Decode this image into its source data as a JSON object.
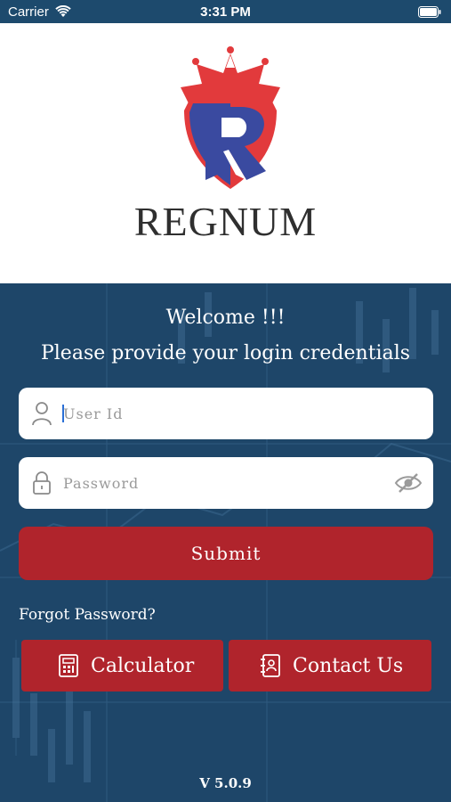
{
  "status_bar": {
    "carrier": "Carrier",
    "time": "3:31 PM"
  },
  "brand": {
    "name": "REGNUM",
    "logo_letter": "R"
  },
  "login": {
    "welcome": "Welcome !!!",
    "instruction": "Please provide your login credentials",
    "user_id": {
      "placeholder": "User Id",
      "value": ""
    },
    "password": {
      "placeholder": "Password",
      "value": ""
    },
    "submit_label": "Submit",
    "forgot_password": "Forgot Password?"
  },
  "actions": {
    "calculator_label": "Calculator",
    "contact_label": "Contact Us"
  },
  "version": "V 5.0.9",
  "colors": {
    "panel_bg": "#1e4669",
    "accent_red": "#b0242c",
    "logo_blue": "#3a4aa0",
    "logo_red": "#e23a3c"
  },
  "icons": [
    "wifi-icon",
    "battery-icon",
    "user-icon",
    "lock-icon",
    "eye-icon",
    "calculator-icon",
    "contact-icon"
  ]
}
